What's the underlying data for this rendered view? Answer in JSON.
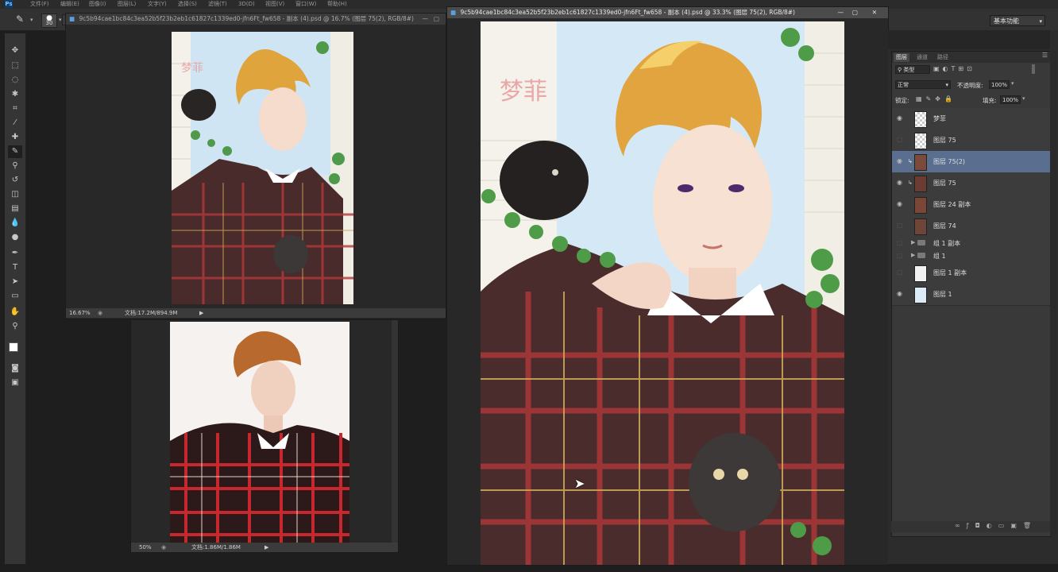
{
  "app": {
    "logo": "Ps"
  },
  "menubar": {
    "items": [
      "文件(F)",
      "编辑(E)",
      "图像(I)",
      "图层(L)",
      "文字(Y)",
      "选择(S)",
      "滤镜(T)",
      "3D(D)",
      "视图(V)",
      "窗口(W)",
      "帮助(H)"
    ]
  },
  "options": {
    "brush_size": "30",
    "workspace": "基本功能"
  },
  "documents": [
    {
      "title": "9c5b94cae1bc84c3ea52b5f23b2eb1c61827c1339ed0-jfn6Ft_fw658 - 副本 (4).psd @ 16.7% (图层 75(2), RGB/8#)",
      "zoom": "16.67%",
      "docinfo": "文档:17.2M/894.9M"
    },
    {
      "zoom": "50%",
      "docinfo": "文档:1.86M/1.86M"
    },
    {
      "title": "9c5b94cae1bc84c3ea52b5f23b2eb1c61827c1339ed0-jfn6Ft_fw658 - 副本 (4).psd @ 33.3% (图层 75(2), RGB/8#)",
      "watermark": "梦菲"
    }
  ],
  "panel_tabs": [
    "图层",
    "通道",
    "路径"
  ],
  "layers_panel": {
    "filter_kind": "类型",
    "blend_mode": "正常",
    "opacity_label": "不透明度:",
    "opacity": "100%",
    "lock_label": "锁定:",
    "fill_label": "填充:",
    "fill": "100%",
    "layers": [
      {
        "name": "梦菲",
        "visible": true,
        "type": "layer"
      },
      {
        "name": "图层 75",
        "visible": false,
        "type": "layer"
      },
      {
        "name": "图层 75(2)",
        "visible": true,
        "type": "layer",
        "selected": true
      },
      {
        "name": "图层 75",
        "visible": true,
        "type": "layer"
      },
      {
        "name": "图层 24 副本",
        "visible": true,
        "type": "layer"
      },
      {
        "name": "图层 74",
        "visible": false,
        "type": "layer"
      },
      {
        "name": "组 1 副本",
        "visible": false,
        "type": "group"
      },
      {
        "name": "组 1",
        "visible": false,
        "type": "group"
      },
      {
        "name": "图层 1 副本",
        "visible": false,
        "type": "layer"
      },
      {
        "name": "图层 1",
        "visible": true,
        "type": "layer"
      }
    ]
  }
}
